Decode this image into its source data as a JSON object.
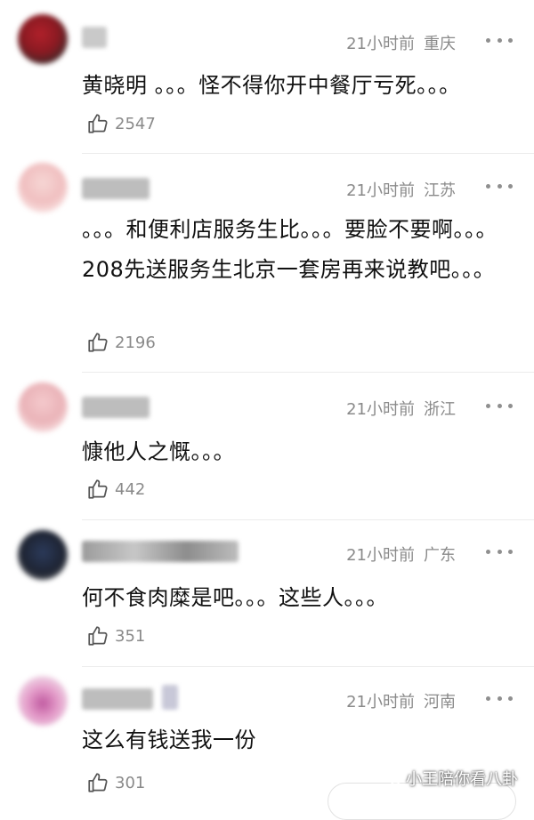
{
  "comments": [
    {
      "time": "21小时前",
      "location": "重庆",
      "text": "黄晓明 。。。怪不得你开中餐厅亏死。。。",
      "likes": "2547"
    },
    {
      "time": "21小时前",
      "location": "江苏",
      "text": "。。。和便利店服务生比。。。要脸不要啊。。。208先送服务生北京一套房再来说教吧。。。",
      "likes": "2196"
    },
    {
      "time": "21小时前",
      "location": "浙江",
      "text": "慷他人之慨。。。",
      "likes": "442"
    },
    {
      "time": "21小时前",
      "location": "广东",
      "text": "何不食肉糜是吧。。。这些人。。。",
      "likes": "351"
    },
    {
      "time": "21小时前",
      "location": "河南",
      "text": "这么有钱送我一份",
      "likes": "301"
    }
  ],
  "watermark": {
    "label": "小王陪你看八卦"
  },
  "colors": {
    "meta": "#8a8a8a",
    "text": "#111111",
    "divider": "#ececec"
  }
}
